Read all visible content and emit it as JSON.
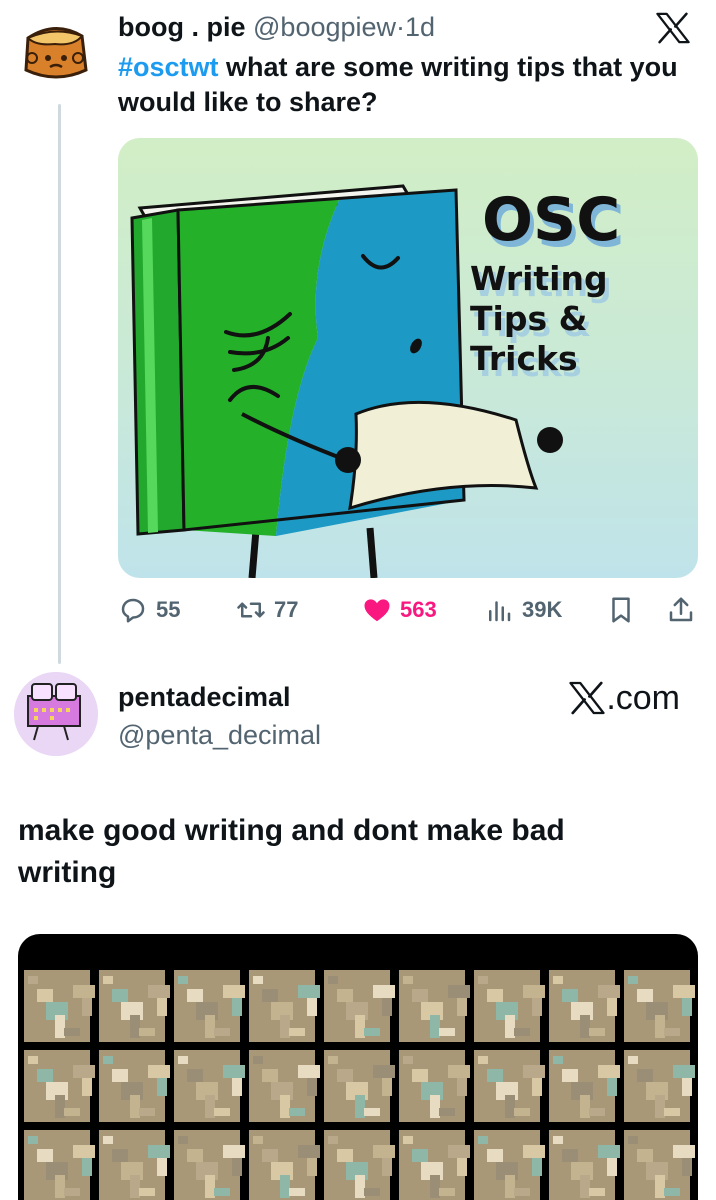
{
  "tweet1": {
    "author_name": "boog . pie",
    "handle": "@boogpiew",
    "separator": "·",
    "time": "1d",
    "hashtag": "#osctwt",
    "text": " what are some writing tips that you would like to share?",
    "image": {
      "title": "OSC",
      "subtitle_line1": "Writing",
      "subtitle_line2": "Tips &",
      "subtitle_line3": "Tricks"
    },
    "actions": {
      "replies": "55",
      "reposts": "77",
      "likes": "563",
      "views": "39K"
    },
    "colors": {
      "hashtag": "#1d9bf0",
      "like": "#f91880",
      "meta": "#536471"
    }
  },
  "tweet2": {
    "author_name": "pentadecimal",
    "handle": "@penta_decimal",
    "brand": ".com",
    "text": "make good writing and dont make bad writing"
  },
  "icons": {
    "x_logo": "x-logo-icon",
    "reply": "reply-icon",
    "repost": "repost-icon",
    "like": "heart-icon",
    "views": "views-icon",
    "bookmark": "bookmark-icon",
    "share": "share-icon"
  }
}
